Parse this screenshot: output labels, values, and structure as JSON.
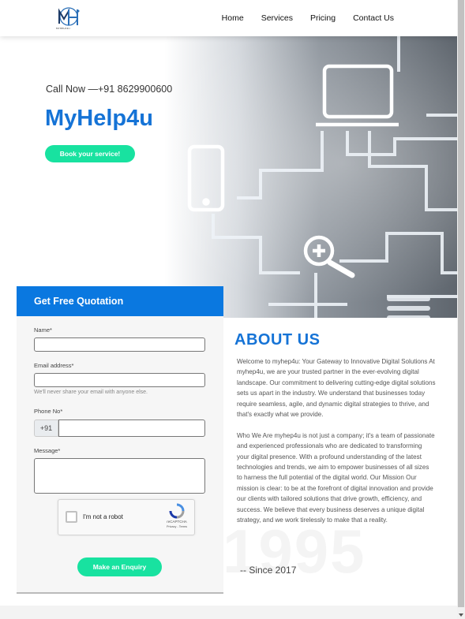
{
  "header": {
    "logo_text": "MYHELP4U",
    "nav": [
      {
        "label": "Home"
      },
      {
        "label": "Services"
      },
      {
        "label": "Pricing"
      },
      {
        "label": "Contact Us"
      }
    ]
  },
  "hero": {
    "call": "Call Now —+91 8629900600",
    "brand": "MyHelp4u",
    "book_button": "Book your service!"
  },
  "quote_form": {
    "title": "Get Free Quotation",
    "name_label": "Name*",
    "name_value": "",
    "email_label": "Email address*",
    "email_value": "",
    "email_help": "We'll never share your email with anyone else.",
    "phone_label": "Phone No*",
    "phone_prefix": "+91",
    "phone_value": "",
    "message_label": "Message*",
    "message_value": "",
    "captcha_label": "I'm not a robot",
    "captcha_brand": "reCAPTCHA",
    "captcha_terms": "Privacy - Terms",
    "submit_button": "Make an Enquiry"
  },
  "about": {
    "title": "ABOUT US",
    "paragraph_1": "Welcome to myhep4u: Your Gateway to Innovative Digital Solutions At myhep4u, we are your trusted partner in the ever-evolving digital landscape. Our commitment to delivering cutting-edge digital solutions sets us apart in the industry. We understand that businesses today require seamless, agile, and dynamic digital strategies to thrive, and that's exactly what we provide.",
    "paragraph_2": "Who We Are myhep4u is not just a company; it's a team of passionate and experienced professionals who are dedicated to transforming your digital presence. With a profound understanding of the latest technologies and trends, we aim to empower businesses of all sizes to harness the full potential of the digital world. Our Mission Our mission is clear: to be at the forefront of digital innovation and provide our clients with tailored solutions that drive growth, efficiency, and success. We believe that every business deserves a unique digital strategy, and we work tirelessly to make that a reality.",
    "watermark": "1995",
    "since": "-- Since 2017"
  },
  "colors": {
    "brand_blue": "#1573d6",
    "form_header": "#0a78e0",
    "button_green": "#18e2a0"
  },
  "icons": [
    "logo-mark",
    "laptop-icon",
    "tablet-icon",
    "magnify-plus-icon",
    "recaptcha-icon"
  ]
}
